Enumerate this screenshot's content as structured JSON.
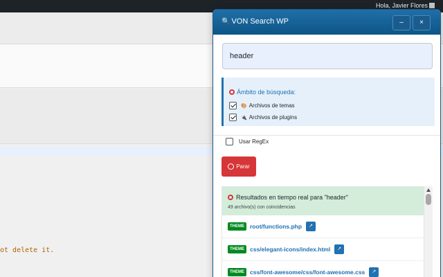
{
  "admin_bar": {
    "greeting": "Hola, Javier Flores"
  },
  "background": {
    "code_snippet": "ot delete it."
  },
  "panel": {
    "title": "VON Search WP",
    "minimize_label": "–",
    "close_label": "×",
    "search": {
      "value": "header"
    },
    "scope": {
      "title": "Ámbito de búsqueda:",
      "options": [
        {
          "label": "Archivos de temas",
          "checked": true,
          "icon": "theme-icon"
        },
        {
          "label": "Archivos de plugins",
          "checked": true,
          "icon": "plugin-icon"
        }
      ]
    },
    "regex": {
      "label": "Usar RegEx",
      "checked": false
    },
    "stop_button": {
      "label": "Parar"
    },
    "results": {
      "title": "Resultados en tiempo real para \"header\"",
      "count": "49 archivo(s) con coincidencias",
      "items": [
        {
          "badge": "THEME",
          "path": "root/functions.php"
        },
        {
          "badge": "THEME",
          "path": "css/elegant-icons/index.html"
        },
        {
          "badge": "THEME",
          "path": "css/font-awesome/css/font-awesome.css"
        }
      ]
    }
  },
  "colors": {
    "header": "#1f6fa8",
    "accent": "#2271b1",
    "stop": "#d63638",
    "theme_badge": "#008a20",
    "results_bg": "#d4edda"
  }
}
